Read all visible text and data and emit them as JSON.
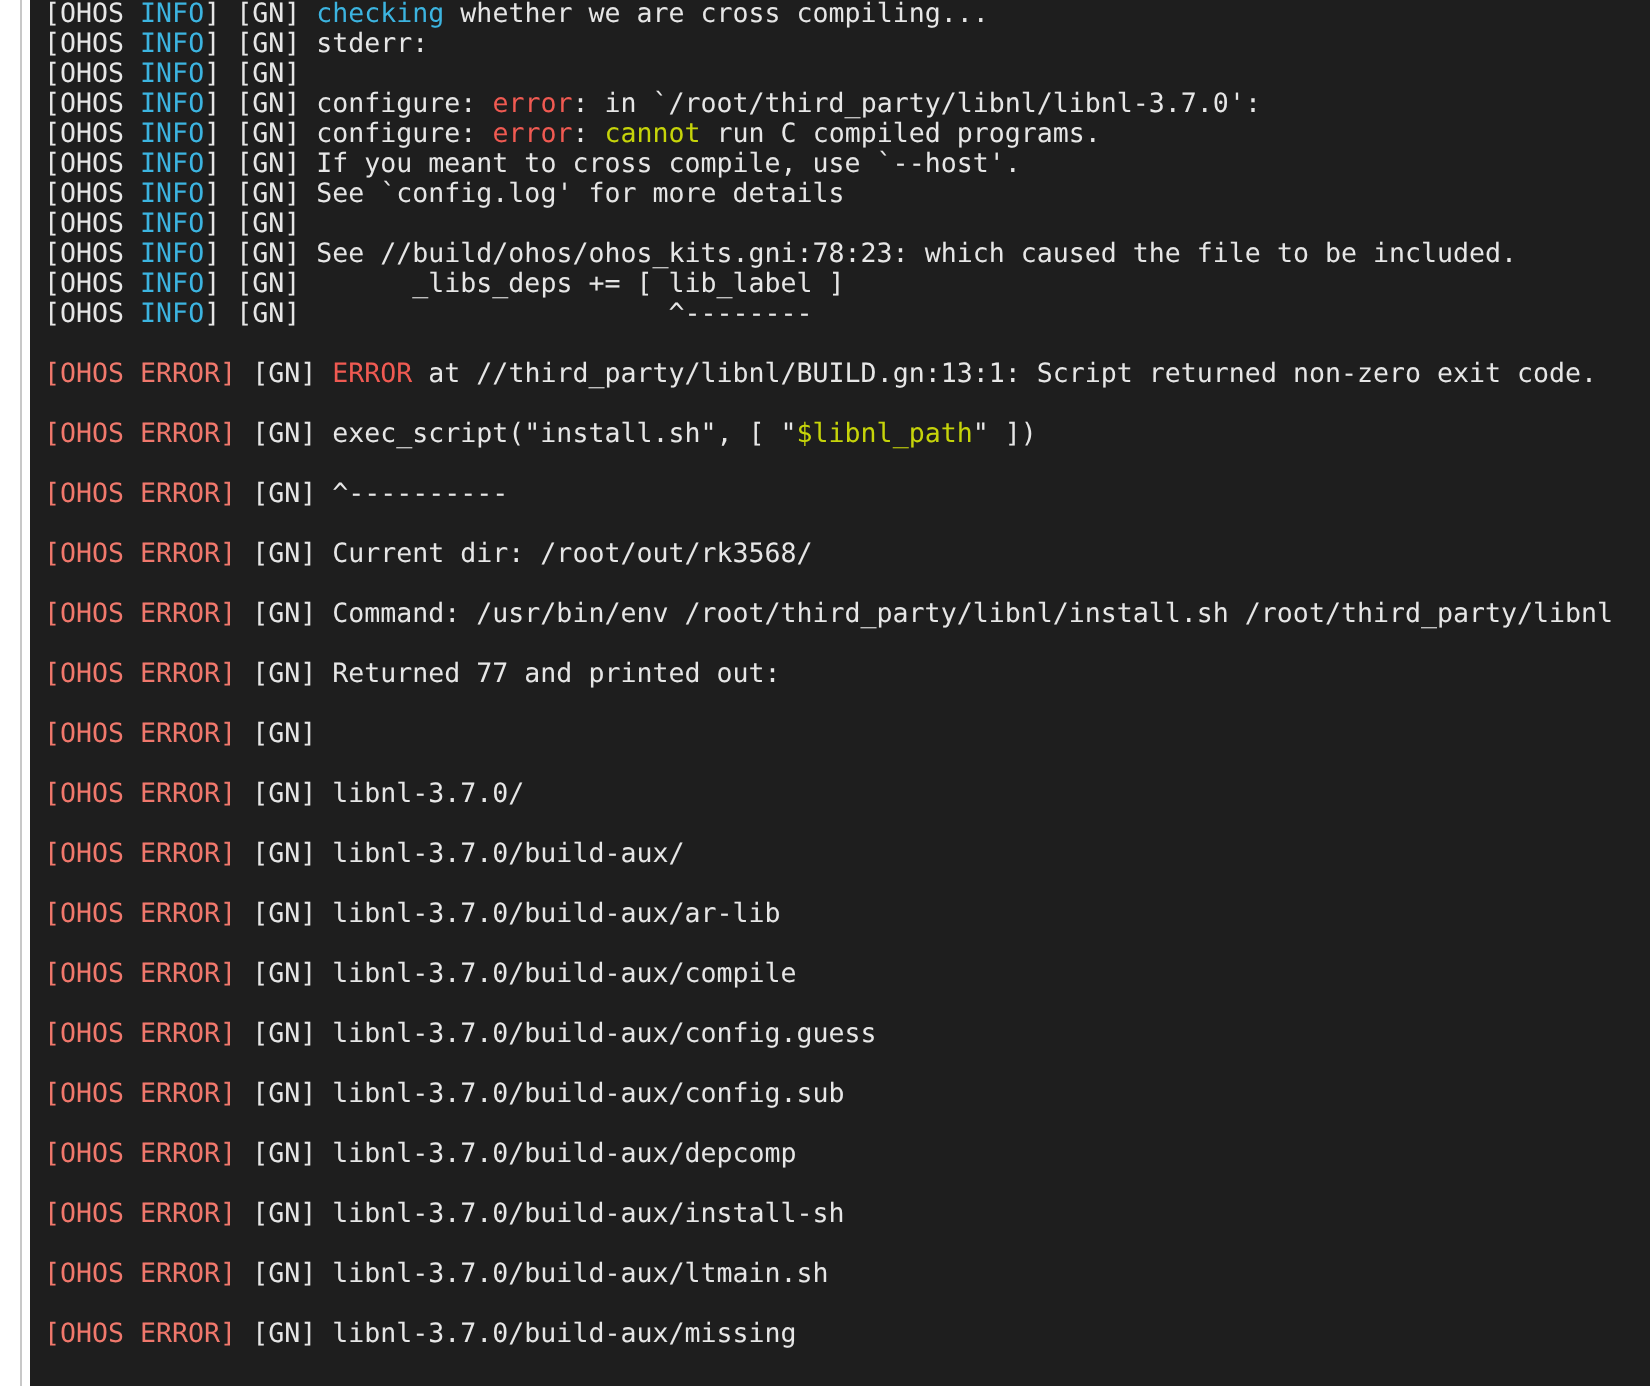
{
  "terminal": {
    "lines": [
      {
        "kind": "info",
        "segments": [
          {
            "text": "[OHOS ",
            "kind": "plain"
          },
          {
            "text": "INFO",
            "kind": "info"
          },
          {
            "text": "] [GN] ",
            "kind": "plain"
          },
          {
            "text": "checking",
            "kind": "keyword"
          },
          {
            "text": " whether we are cross compiling...",
            "kind": "plain"
          }
        ]
      },
      {
        "kind": "info",
        "segments": [
          {
            "text": "[OHOS ",
            "kind": "plain"
          },
          {
            "text": "INFO",
            "kind": "info"
          },
          {
            "text": "] [GN] stderr:",
            "kind": "plain"
          }
        ]
      },
      {
        "kind": "info",
        "segments": [
          {
            "text": "[OHOS ",
            "kind": "plain"
          },
          {
            "text": "INFO",
            "kind": "info"
          },
          {
            "text": "] [GN]",
            "kind": "plain"
          }
        ]
      },
      {
        "kind": "info",
        "segments": [
          {
            "text": "[OHOS ",
            "kind": "plain"
          },
          {
            "text": "INFO",
            "kind": "info"
          },
          {
            "text": "] [GN] configure: ",
            "kind": "plain"
          },
          {
            "text": "error",
            "kind": "error"
          },
          {
            "text": ": in `/root/third_party/libnl/libnl-3.7.0':",
            "kind": "plain"
          }
        ]
      },
      {
        "kind": "info",
        "segments": [
          {
            "text": "[OHOS ",
            "kind": "plain"
          },
          {
            "text": "INFO",
            "kind": "info"
          },
          {
            "text": "] [GN] configure: ",
            "kind": "plain"
          },
          {
            "text": "error",
            "kind": "error"
          },
          {
            "text": ": ",
            "kind": "plain"
          },
          {
            "text": "cannot",
            "kind": "warn"
          },
          {
            "text": " run C compiled programs.",
            "kind": "plain"
          }
        ]
      },
      {
        "kind": "info",
        "segments": [
          {
            "text": "[OHOS ",
            "kind": "plain"
          },
          {
            "text": "INFO",
            "kind": "info"
          },
          {
            "text": "] [GN] If you meant to cross compile, use `--host'.",
            "kind": "plain"
          }
        ]
      },
      {
        "kind": "info",
        "segments": [
          {
            "text": "[OHOS ",
            "kind": "plain"
          },
          {
            "text": "INFO",
            "kind": "info"
          },
          {
            "text": "] [GN] See `config.log' for more details",
            "kind": "plain"
          }
        ]
      },
      {
        "kind": "info",
        "segments": [
          {
            "text": "[OHOS ",
            "kind": "plain"
          },
          {
            "text": "INFO",
            "kind": "info"
          },
          {
            "text": "] [GN]",
            "kind": "plain"
          }
        ]
      },
      {
        "kind": "info",
        "segments": [
          {
            "text": "[OHOS ",
            "kind": "plain"
          },
          {
            "text": "INFO",
            "kind": "info"
          },
          {
            "text": "] [GN] See //build/ohos/ohos_kits.gni:78:23: which caused the file to be included.",
            "kind": "plain"
          }
        ]
      },
      {
        "kind": "info",
        "segments": [
          {
            "text": "[OHOS ",
            "kind": "plain"
          },
          {
            "text": "INFO",
            "kind": "info"
          },
          {
            "text": "] [GN]       _libs_deps += [ lib_label ]",
            "kind": "plain"
          }
        ]
      },
      {
        "kind": "info",
        "segments": [
          {
            "text": "[OHOS ",
            "kind": "plain"
          },
          {
            "text": "INFO",
            "kind": "info"
          },
          {
            "text": "] [GN]                       ^--------",
            "kind": "plain"
          }
        ]
      },
      {
        "kind": "error",
        "segments": [
          {
            "text": "[OHOS ERROR]",
            "kind": "label"
          },
          {
            "text": " [GN] ",
            "kind": "plain"
          },
          {
            "text": "ERROR",
            "kind": "error"
          },
          {
            "text": " at //third_party/libnl/BUILD.gn:13:1: Script returned non-zero exit code.",
            "kind": "plain"
          }
        ]
      },
      {
        "kind": "error",
        "segments": [
          {
            "text": "[OHOS ERROR]",
            "kind": "label"
          },
          {
            "text": " [GN] exec_script(\"install.sh\", [ \"",
            "kind": "plain"
          },
          {
            "text": "$libnl_path",
            "kind": "warn"
          },
          {
            "text": "\" ])",
            "kind": "plain"
          }
        ]
      },
      {
        "kind": "error",
        "segments": [
          {
            "text": "[OHOS ERROR]",
            "kind": "label"
          },
          {
            "text": " [GN] ^----------",
            "kind": "plain"
          }
        ]
      },
      {
        "kind": "error",
        "segments": [
          {
            "text": "[OHOS ERROR]",
            "kind": "label"
          },
          {
            "text": " [GN] Current dir: /root/out/rk3568/",
            "kind": "plain"
          }
        ]
      },
      {
        "kind": "error",
        "segments": [
          {
            "text": "[OHOS ERROR]",
            "kind": "label"
          },
          {
            "text": " [GN] Command: /usr/bin/env /root/third_party/libnl/install.sh /root/third_party/libnl",
            "kind": "plain"
          }
        ]
      },
      {
        "kind": "error",
        "segments": [
          {
            "text": "[OHOS ERROR]",
            "kind": "label"
          },
          {
            "text": " [GN] Returned 77 and printed out:",
            "kind": "plain"
          }
        ]
      },
      {
        "kind": "error",
        "segments": [
          {
            "text": "[OHOS ERROR]",
            "kind": "label"
          },
          {
            "text": " [GN]",
            "kind": "plain"
          }
        ]
      },
      {
        "kind": "error",
        "segments": [
          {
            "text": "[OHOS ERROR]",
            "kind": "label"
          },
          {
            "text": " [GN] libnl-3.7.0/",
            "kind": "plain"
          }
        ]
      },
      {
        "kind": "error",
        "segments": [
          {
            "text": "[OHOS ERROR]",
            "kind": "label"
          },
          {
            "text": " [GN] libnl-3.7.0/build-aux/",
            "kind": "plain"
          }
        ]
      },
      {
        "kind": "error",
        "segments": [
          {
            "text": "[OHOS ERROR]",
            "kind": "label"
          },
          {
            "text": " [GN] libnl-3.7.0/build-aux/ar-lib",
            "kind": "plain"
          }
        ]
      },
      {
        "kind": "error",
        "segments": [
          {
            "text": "[OHOS ERROR]",
            "kind": "label"
          },
          {
            "text": " [GN] libnl-3.7.0/build-aux/compile",
            "kind": "plain"
          }
        ]
      },
      {
        "kind": "error",
        "segments": [
          {
            "text": "[OHOS ERROR]",
            "kind": "label"
          },
          {
            "text": " [GN] libnl-3.7.0/build-aux/config.guess",
            "kind": "plain"
          }
        ]
      },
      {
        "kind": "error",
        "segments": [
          {
            "text": "[OHOS ERROR]",
            "kind": "label"
          },
          {
            "text": " [GN] libnl-3.7.0/build-aux/config.sub",
            "kind": "plain"
          }
        ]
      },
      {
        "kind": "error",
        "segments": [
          {
            "text": "[OHOS ERROR]",
            "kind": "label"
          },
          {
            "text": " [GN] libnl-3.7.0/build-aux/depcomp",
            "kind": "plain"
          }
        ]
      },
      {
        "kind": "error",
        "segments": [
          {
            "text": "[OHOS ERROR]",
            "kind": "label"
          },
          {
            "text": " [GN] libnl-3.7.0/build-aux/install-sh",
            "kind": "plain"
          }
        ]
      },
      {
        "kind": "error",
        "segments": [
          {
            "text": "[OHOS ERROR]",
            "kind": "label"
          },
          {
            "text": " [GN] libnl-3.7.0/build-aux/ltmain.sh",
            "kind": "plain"
          }
        ]
      },
      {
        "kind": "error",
        "segments": [
          {
            "text": "[OHOS ERROR]",
            "kind": "label"
          },
          {
            "text": " [GN] libnl-3.7.0/build-aux/missing",
            "kind": "plain"
          }
        ]
      }
    ]
  }
}
